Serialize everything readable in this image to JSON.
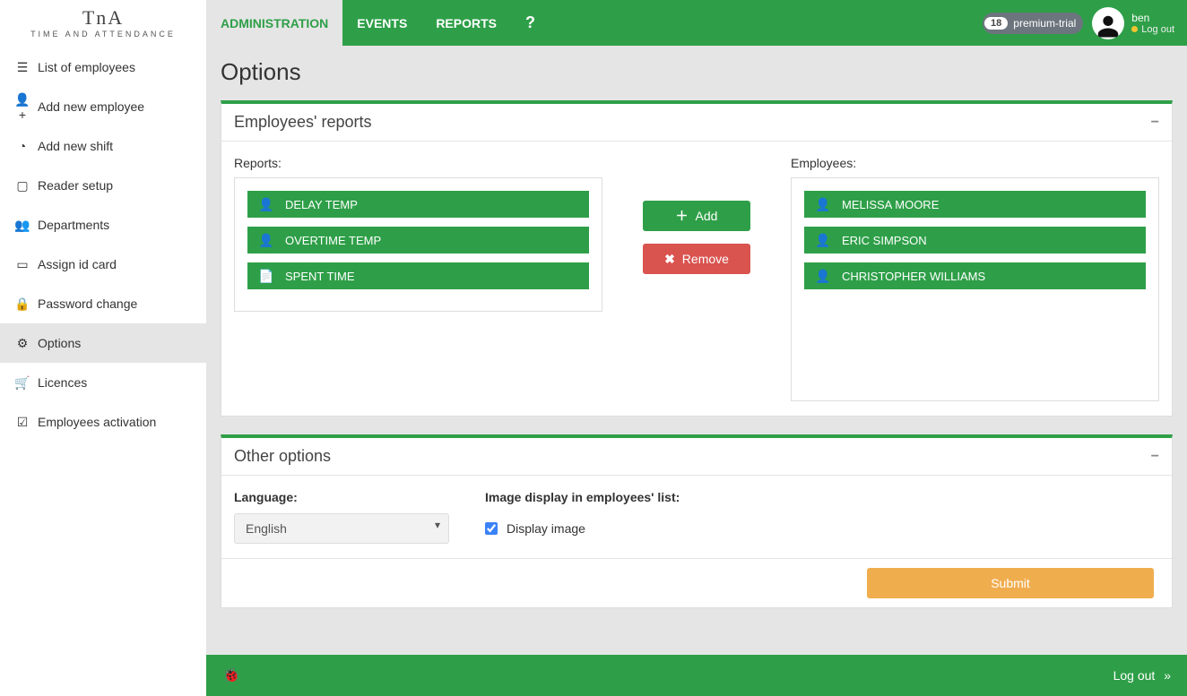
{
  "brand": {
    "mark": "TnA",
    "sub": "TIME AND ATTENDANCE"
  },
  "topnav": {
    "tabs": {
      "admin": "ADMINISTRATION",
      "events": "EVENTS",
      "reports": "REPORTS",
      "help": "?"
    },
    "plan": {
      "days": "18",
      "label": "premium-trial"
    },
    "user": {
      "name": "ben",
      "logout": "Log out"
    }
  },
  "sidebar": {
    "items": [
      {
        "id": "list-employees",
        "icon": "list",
        "label": "List of employees"
      },
      {
        "id": "add-employee",
        "icon": "user-plus",
        "label": "Add new employee"
      },
      {
        "id": "add-shift",
        "icon": "clock",
        "label": "Add new shift"
      },
      {
        "id": "reader-setup",
        "icon": "tablet",
        "label": "Reader setup"
      },
      {
        "id": "departments",
        "icon": "users",
        "label": "Departments"
      },
      {
        "id": "assign-id",
        "icon": "card",
        "label": "Assign id card"
      },
      {
        "id": "password-change",
        "icon": "lock",
        "label": "Password change"
      },
      {
        "id": "options",
        "icon": "gear",
        "label": "Options"
      },
      {
        "id": "licences",
        "icon": "cart",
        "label": "Licences"
      },
      {
        "id": "activation",
        "icon": "check",
        "label": "Employees activation"
      }
    ],
    "activeId": "options"
  },
  "page": {
    "title": "Options"
  },
  "panels": {
    "reports": {
      "title": "Employees' reports",
      "labels": {
        "reports": "Reports:",
        "employees": "Employees:"
      },
      "reportsList": [
        {
          "icon": "person",
          "name": "DELAY TEMP"
        },
        {
          "icon": "person",
          "name": "OVERTIME TEMP"
        },
        {
          "icon": "doc",
          "name": "SPENT TIME"
        }
      ],
      "employeesList": [
        {
          "name": "MELISSA MOORE"
        },
        {
          "name": "ERIC SIMPSON"
        },
        {
          "name": "CHRISTOPHER WILLIAMS"
        }
      ],
      "buttons": {
        "add": "Add",
        "remove": "Remove"
      }
    },
    "other": {
      "title": "Other options",
      "language": {
        "label": "Language:",
        "value": "English"
      },
      "imageDisplay": {
        "label": "Image display in employees' list:",
        "checkboxLabel": "Display image",
        "checked": true
      },
      "submit": "Submit"
    }
  },
  "footer": {
    "logout": "Log out"
  }
}
